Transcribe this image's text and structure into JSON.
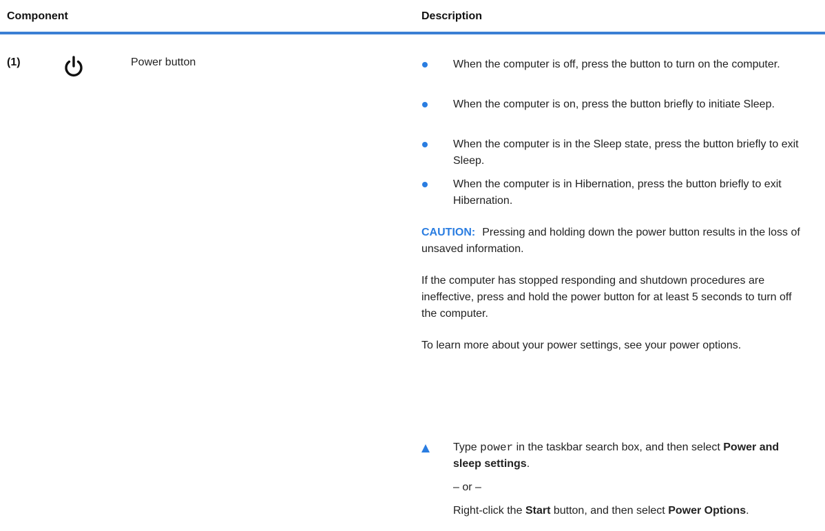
{
  "header": {
    "component_label": "Component",
    "description_label": "Description"
  },
  "row": {
    "number": "(1)",
    "icon": "power-icon",
    "component": "Power button",
    "bullets": [
      "When the computer is off, press the button to turn on the computer.",
      "When the computer is on, press the button briefly to initiate Sleep.",
      "When the computer is in the Sleep state, press the button briefly to exit Sleep.",
      "When the computer is in Hibernation, press the button briefly to exit Hibernation."
    ],
    "caution_label": "CAUTION:",
    "caution_text": "Pressing and holding down the power button results in the loss of unsaved information.",
    "para_stop": "If the computer has stopped responding and shutdown procedures are ineffective, press and hold the power button for at least 5 seconds to turn off the computer.",
    "para_learn": "To learn more about your power settings, see your power options.",
    "step": {
      "type_word": "Type",
      "code": "power",
      "after_code": "in the taskbar search box, and then select",
      "setting_bold": "Power and sleep settings",
      "period": ".",
      "or_text": "– or –",
      "right_click": "Right-click the",
      "start_bold": "Start",
      "then_select": "button, and then select",
      "power_options_bold": "Power Options",
      "period2": "."
    }
  },
  "colors": {
    "accent": "#2a7de1",
    "rule": "#3b7fd4",
    "text": "#222222"
  }
}
